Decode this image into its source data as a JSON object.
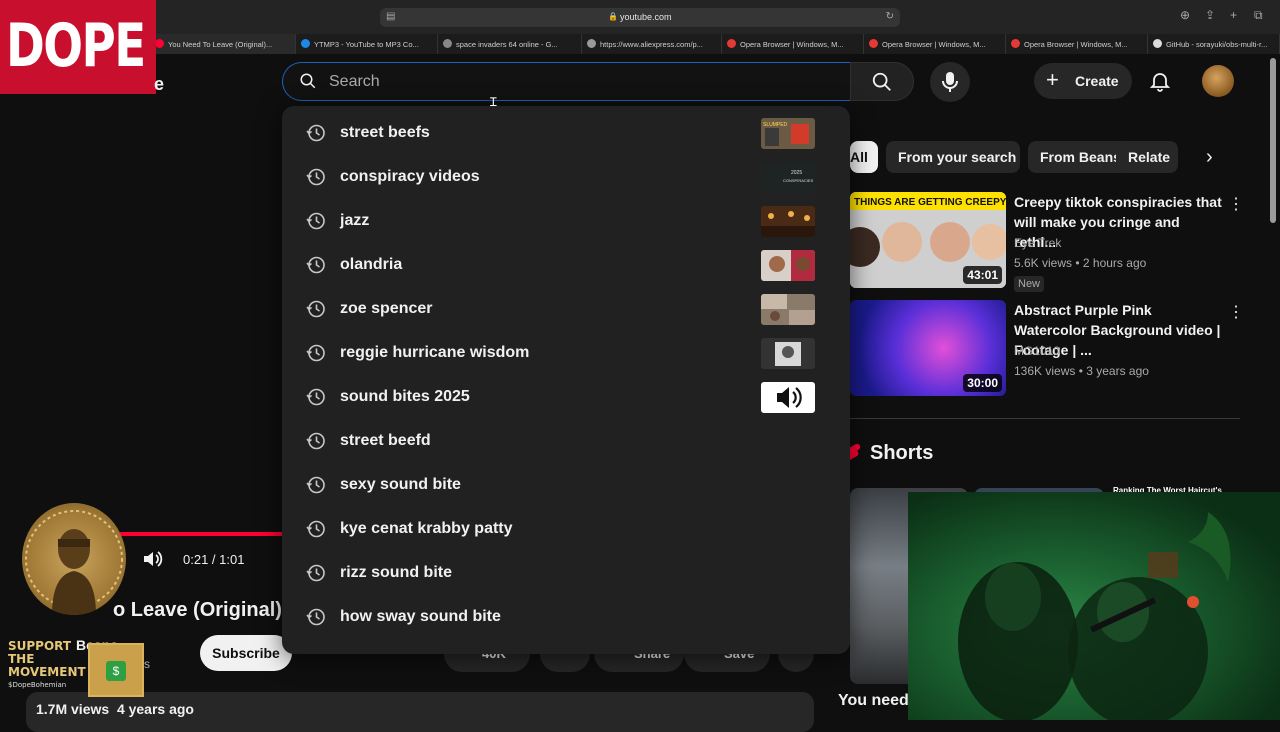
{
  "browser": {
    "url": "youtube.com",
    "tabs": [
      {
        "label": "You Need To Leave (Original)...",
        "color": "#ff0033",
        "active": true
      },
      {
        "label": "YTMP3 - YouTube to MP3 Co...",
        "color": "#1e88e5"
      },
      {
        "label": "space invaders 64 online - G...",
        "color": "#888888"
      },
      {
        "label": "https://www.aliexpress.com/p...",
        "color": "#999999"
      },
      {
        "label": "Opera Browser | Windows, M...",
        "color": "#e53935"
      },
      {
        "label": "Opera Browser | Windows, M...",
        "color": "#e53935"
      },
      {
        "label": "Opera Browser | Windows, M...",
        "color": "#e53935"
      },
      {
        "label": "GitHub - sorayuki/obs-multi-r...",
        "color": "#dddddd"
      }
    ]
  },
  "overlay": {
    "dope_logo": "DOPE",
    "support_line1": "SUPPORT THE",
    "support_line2": "MOVEMENT",
    "handle": "$DopeBohemian",
    "qr_symbol": "$"
  },
  "header": {
    "logo_fragment": "e",
    "search_placeholder": "Search",
    "create_label": "Create",
    "icons": {
      "search": "search-icon",
      "mic": "mic-icon",
      "bell": "bell-icon",
      "plus": "plus-icon"
    }
  },
  "suggestions": [
    {
      "term": "street beefs",
      "thumb": "street"
    },
    {
      "term": "conspiracy videos",
      "thumb": "dark"
    },
    {
      "term": "jazz",
      "thumb": "warm"
    },
    {
      "term": "olandria",
      "thumb": "people"
    },
    {
      "term": "zoe spencer",
      "thumb": "people2"
    },
    {
      "term": "reggie hurricane wisdom",
      "thumb": "bw"
    },
    {
      "term": "sound bites 2025",
      "thumb": "speaker"
    },
    {
      "term": "street beefd",
      "thumb": ""
    },
    {
      "term": "sexy sound bite",
      "thumb": ""
    },
    {
      "term": "kye cenat krabby patty",
      "thumb": ""
    },
    {
      "term": "rizz sound bite",
      "thumb": ""
    },
    {
      "term": "how sway sound bite",
      "thumb": ""
    }
  ],
  "player": {
    "time": "0:21 / 1:01",
    "title_fragment": "o Leave (Original)",
    "channel": "Beans",
    "subs_fragment": "ribers",
    "subscribe": "Subscribe",
    "likes": "40K",
    "share": "Share",
    "save": "Save",
    "views": "1.7M views",
    "age": "4 years ago"
  },
  "chips": [
    {
      "label": "All",
      "selected": true
    },
    {
      "label": "From your search",
      "selected": false
    },
    {
      "label": "From Beans",
      "selected": false
    },
    {
      "label": "Relate",
      "selected": false
    }
  ],
  "recommendations": [
    {
      "title": "Creepy tiktok conspiracies that will make you cringe and rethi...",
      "channel": "Eye Trek",
      "views": "5.6K views",
      "age": "2 hours ago",
      "badge": "New",
      "duration": "43:01",
      "thumb_text": "THINGS ARE GETTING CREEPY"
    },
    {
      "title": "Abstract Purple Pink Watercolor Background video | Footage | ...",
      "channel": "MG1010",
      "views": "136K views",
      "age": "3 years ago",
      "badge": "",
      "duration": "30:00",
      "thumb_text": ""
    }
  ],
  "shorts": {
    "title": "Shorts",
    "short3_label": "Ranking The Worst Haircut's",
    "caption": "You need"
  },
  "thumb_labels": {
    "street": "SLUMPED",
    "dark_line1": "2025",
    "dark_line2": "CONSPIRACIES"
  }
}
